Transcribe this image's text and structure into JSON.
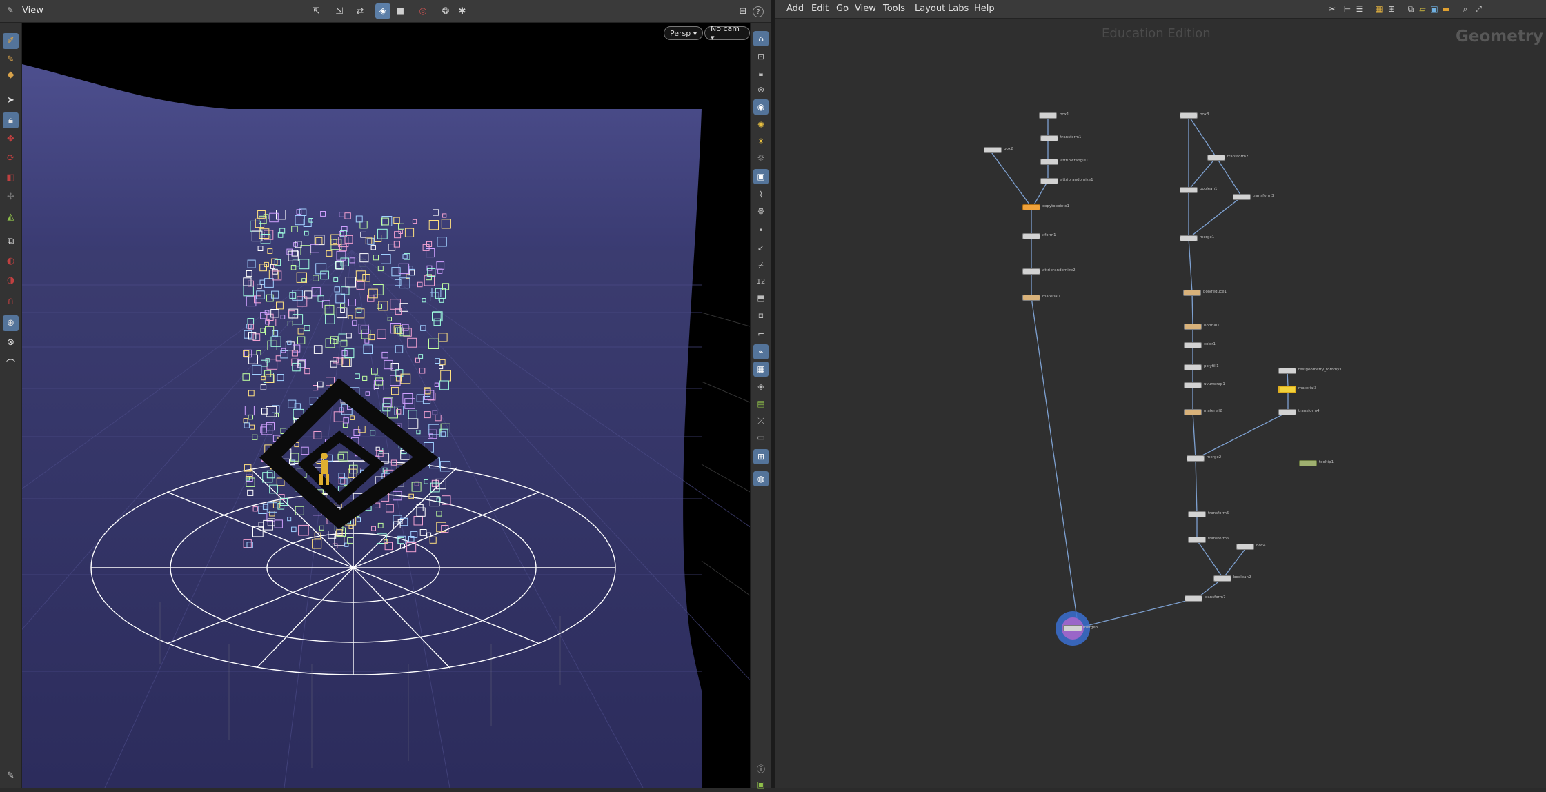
{
  "viewer": {
    "title": "View",
    "camera_menu": "Persp ▾",
    "cam_menu": "No cam ▾",
    "help_icon": "?"
  },
  "menubar": {
    "items": [
      "Add",
      "Edit",
      "Go",
      "View",
      "Tools",
      "Layout",
      "Labs",
      "Help"
    ]
  },
  "network": {
    "watermark": "Education Edition",
    "context": "Geometry",
    "nodes": [
      {
        "label": "box1"
      },
      {
        "label": "transform1"
      },
      {
        "label": "attribwrangle1"
      },
      {
        "label": "attribrandomize1"
      },
      {
        "label": "box2"
      },
      {
        "label": "copytopoints1"
      },
      {
        "label": "xform1"
      },
      {
        "label": "attribrandomize2"
      },
      {
        "label": "material1"
      },
      {
        "label": "box3"
      },
      {
        "label": "transform2"
      },
      {
        "label": "boolean1"
      },
      {
        "label": "transform3"
      },
      {
        "label": "merge1"
      },
      {
        "label": "polyreduce1"
      },
      {
        "label": "normal1"
      },
      {
        "label": "color1"
      },
      {
        "label": "polyfill1"
      },
      {
        "label": "uvunwrap1"
      },
      {
        "label": "material2"
      },
      {
        "label": "testgeometry_tommy1"
      },
      {
        "label": "material3"
      },
      {
        "label": "transform4"
      },
      {
        "label": "merge2"
      },
      {
        "label": "tooltip1"
      },
      {
        "label": "transform5"
      },
      {
        "label": "transform6"
      },
      {
        "label": "box4"
      },
      {
        "label": "boolean2"
      },
      {
        "label": "transform7"
      },
      {
        "label": "merge3"
      }
    ]
  },
  "colors": {
    "ground": "#34346a",
    "wall": "#4d4f8c",
    "selection": "#54749a",
    "output_ring": "#3a6fd0"
  }
}
